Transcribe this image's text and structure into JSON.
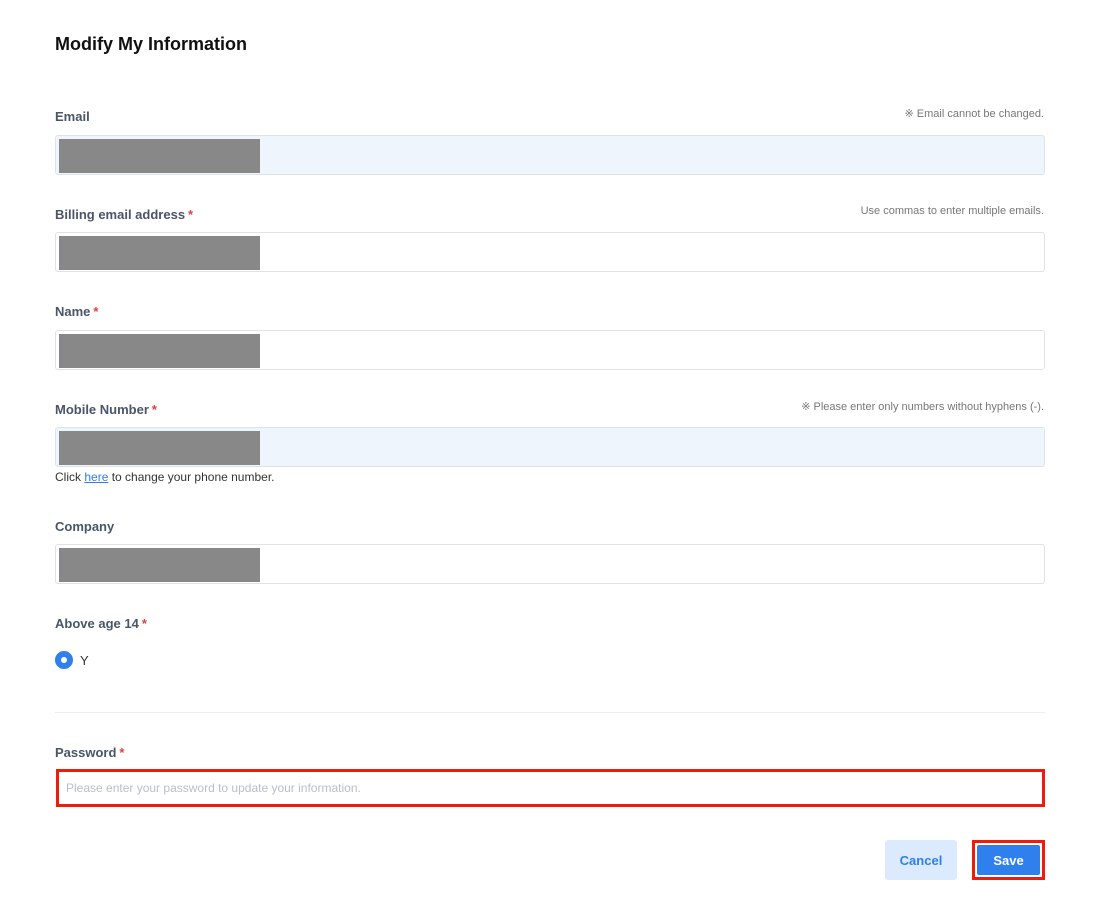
{
  "page": {
    "title": "Modify My Information"
  },
  "email": {
    "label": "Email",
    "hint": "※ Email cannot be changed."
  },
  "billing_email": {
    "label": "Billing email address",
    "required_mark": "*",
    "hint": "Use commas to enter multiple emails."
  },
  "name": {
    "label": "Name",
    "required_mark": "*"
  },
  "mobile": {
    "label": "Mobile Number",
    "required_mark": "*",
    "hint": "※ Please enter only numbers without hyphens (-).",
    "note_prefix": "Click ",
    "note_link": "here",
    "note_suffix": " to change your phone number."
  },
  "company": {
    "label": "Company"
  },
  "age": {
    "label": "Above age 14",
    "required_mark": "*",
    "option_label": "Y",
    "selected": true
  },
  "password": {
    "label": "Password",
    "required_mark": "*",
    "placeholder": "Please enter your password to update your information."
  },
  "actions": {
    "cancel_label": "Cancel",
    "save_label": "Save"
  },
  "colors": {
    "accent": "#2f80ed",
    "required": "#e53e3e",
    "highlight": "#ee1c0c",
    "readonly_bg": "#eff5fd"
  }
}
